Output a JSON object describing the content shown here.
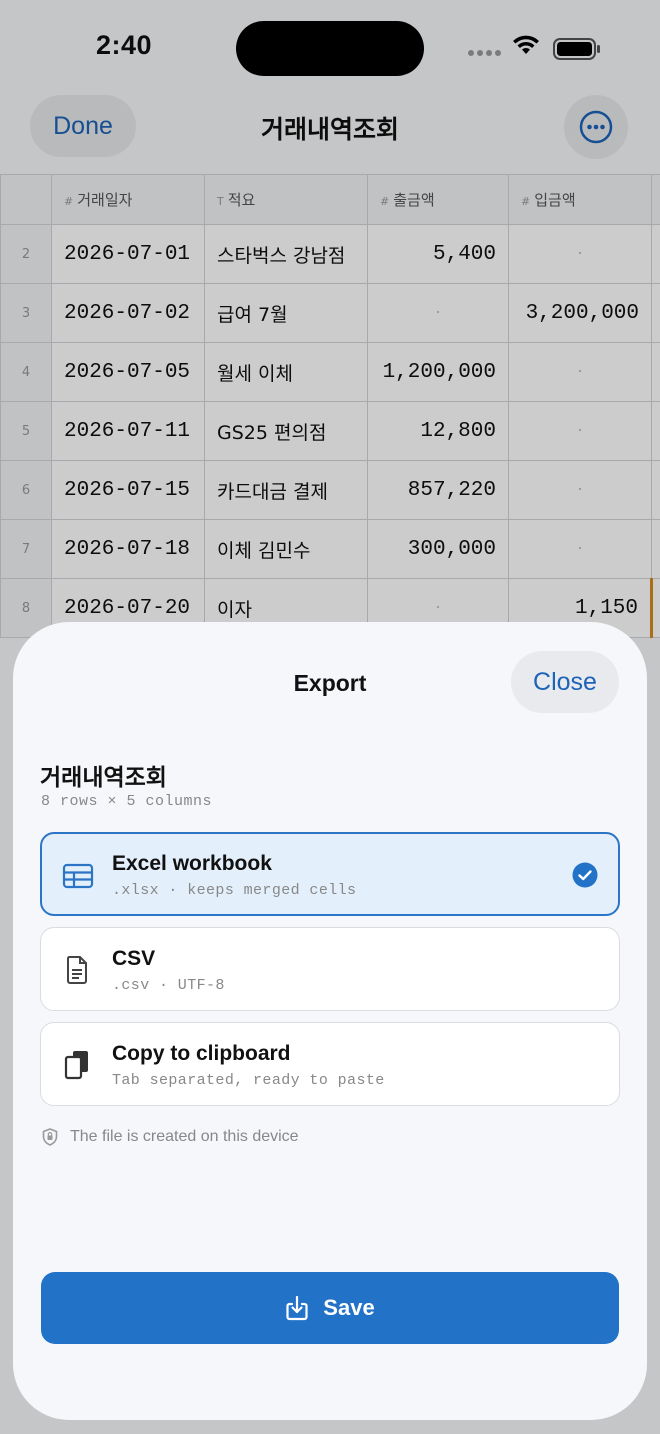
{
  "status_bar": {
    "time": "2:40"
  },
  "nav": {
    "done_label": "Done",
    "title": "거래내역조회",
    "more_icon": "ellipsis-circle-icon"
  },
  "grid": {
    "columns": [
      {
        "type": "#",
        "label": "거래일자"
      },
      {
        "type": "T",
        "label": "적요"
      },
      {
        "type": "#",
        "label": "출금액"
      },
      {
        "type": "#",
        "label": "입금액"
      }
    ],
    "rows": [
      {
        "num": "2",
        "date": "2026-07-01",
        "memo": "스타벅스 강남점",
        "out": "5,400",
        "in": "·"
      },
      {
        "num": "3",
        "date": "2026-07-02",
        "memo": "급여 7월",
        "out": "·",
        "in": "3,200,000"
      },
      {
        "num": "4",
        "date": "2026-07-05",
        "memo": "월세 이체",
        "out": "1,200,000",
        "in": "·"
      },
      {
        "num": "5",
        "date": "2026-07-11",
        "memo": "GS25 편의점",
        "out": "12,800",
        "in": "·"
      },
      {
        "num": "6",
        "date": "2026-07-15",
        "memo": "카드대금 결제",
        "out": "857,220",
        "in": "·"
      },
      {
        "num": "7",
        "date": "2026-07-18",
        "memo": "이체 김민수",
        "out": "300,000",
        "in": "·"
      },
      {
        "num": "8",
        "date": "2026-07-20",
        "memo": "이자",
        "out": "·",
        "in": "1,150"
      }
    ]
  },
  "export_sheet": {
    "title": "Export",
    "close_label": "Close",
    "doc_name": "거래내역조회",
    "doc_meta": "8 rows × 5 columns",
    "options": [
      {
        "title": "Excel workbook",
        "subtitle": ".xlsx · keeps merged cells",
        "icon": "table-icon",
        "selected": true
      },
      {
        "title": "CSV",
        "subtitle": ".csv · UTF-8",
        "icon": "document-icon",
        "selected": false
      },
      {
        "title": "Copy to clipboard",
        "subtitle": "Tab separated, ready to paste",
        "icon": "copy-icon",
        "selected": false
      }
    ],
    "privacy_note": "The file is created on this device",
    "save_label": "Save"
  },
  "colors": {
    "accent": "#2272c8",
    "selected_bg": "#e3f0fc",
    "active_cell": "#d68a1a"
  }
}
